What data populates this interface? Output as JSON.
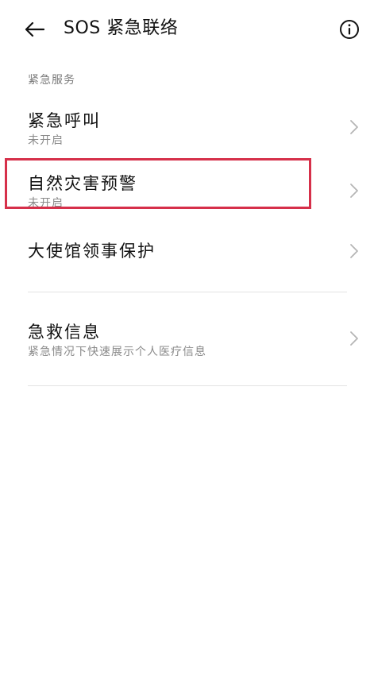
{
  "header": {
    "title": "SOS 紧急联络",
    "back_icon": "arrow-left-icon",
    "info_icon": "info-icon"
  },
  "section": {
    "label": "紧急服务"
  },
  "items": [
    {
      "title": "紧急呼叫",
      "subtitle": "未开启"
    },
    {
      "title": "自然灾害预警",
      "subtitle": "未开启"
    },
    {
      "title": "大使馆领事保护"
    },
    {
      "title": "急救信息",
      "subtitle": "紧急情况下快速展示个人医疗信息"
    }
  ],
  "colors": {
    "highlight": "#d6304a",
    "text": "#111111",
    "subtext": "#8a8a8a"
  }
}
